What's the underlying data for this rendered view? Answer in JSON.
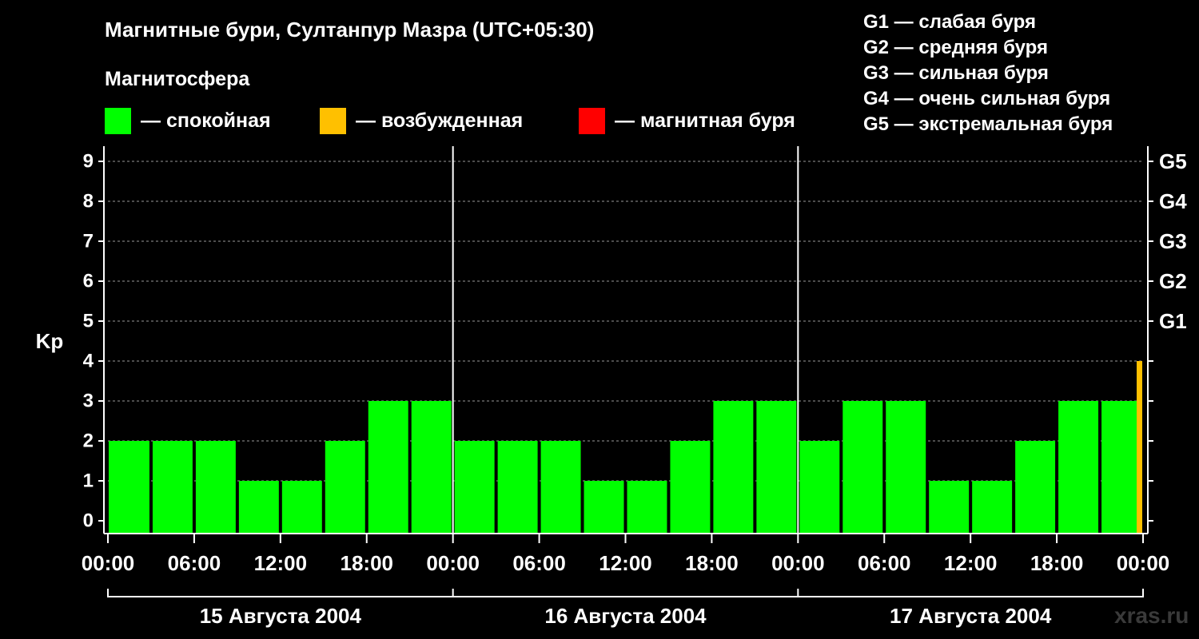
{
  "title": "Магнитные бури, Султанпур Мазра (UTC+05:30)",
  "magnetosphere_label": "Магнитосфера",
  "legend": [
    {
      "color": "#00ff00",
      "label": "— спокойная"
    },
    {
      "color": "#ffc000",
      "label": "— возбужденная"
    },
    {
      "color": "#ff0000",
      "label": "— магнитная буря"
    }
  ],
  "g_scale": [
    "G1 — слабая буря",
    "G2 — средняя буря",
    "G3 — сильная буря",
    "G4 — очень сильная буря",
    "G5 — экстремальная буря"
  ],
  "watermark": "xras.ru",
  "chart_data": {
    "type": "bar",
    "ylabel": "Kp",
    "ylim": [
      0,
      9
    ],
    "y_ticks": [
      "0",
      "1",
      "2",
      "3",
      "4",
      "5",
      "6",
      "7",
      "8",
      "9"
    ],
    "right_axis_ticks": [
      {
        "value": 5,
        "label": "G1"
      },
      {
        "value": 6,
        "label": "G2"
      },
      {
        "value": 7,
        "label": "G3"
      },
      {
        "value": 8,
        "label": "G4"
      },
      {
        "value": 9,
        "label": "G5"
      }
    ],
    "x_tick_labels": [
      "00:00",
      "06:00",
      "12:00",
      "18:00",
      "00:00",
      "06:00",
      "12:00",
      "18:00",
      "00:00",
      "06:00",
      "12:00",
      "18:00",
      "00:00"
    ],
    "days": [
      "15 Августа 2004",
      "16 Августа 2004",
      "17 Августа 2004"
    ],
    "bars": [
      {
        "start_hour": 0,
        "end_hour": 3,
        "value": 2,
        "color": "#00ff00"
      },
      {
        "start_hour": 3,
        "end_hour": 6,
        "value": 2,
        "color": "#00ff00"
      },
      {
        "start_hour": 6,
        "end_hour": 9,
        "value": 2,
        "color": "#00ff00"
      },
      {
        "start_hour": 9,
        "end_hour": 12,
        "value": 1,
        "color": "#00ff00"
      },
      {
        "start_hour": 12,
        "end_hour": 15,
        "value": 1,
        "color": "#00ff00"
      },
      {
        "start_hour": 15,
        "end_hour": 18,
        "value": 2,
        "color": "#00ff00"
      },
      {
        "start_hour": 18,
        "end_hour": 21,
        "value": 3,
        "color": "#00ff00"
      },
      {
        "start_hour": 21,
        "end_hour": 24,
        "value": 3,
        "color": "#00ff00"
      },
      {
        "start_hour": 24,
        "end_hour": 27,
        "value": 2,
        "color": "#00ff00"
      },
      {
        "start_hour": 27,
        "end_hour": 30,
        "value": 2,
        "color": "#00ff00"
      },
      {
        "start_hour": 30,
        "end_hour": 33,
        "value": 2,
        "color": "#00ff00"
      },
      {
        "start_hour": 33,
        "end_hour": 36,
        "value": 1,
        "color": "#00ff00"
      },
      {
        "start_hour": 36,
        "end_hour": 39,
        "value": 1,
        "color": "#00ff00"
      },
      {
        "start_hour": 39,
        "end_hour": 42,
        "value": 2,
        "color": "#00ff00"
      },
      {
        "start_hour": 42,
        "end_hour": 45,
        "value": 3,
        "color": "#00ff00"
      },
      {
        "start_hour": 45,
        "end_hour": 48,
        "value": 3,
        "color": "#00ff00"
      },
      {
        "start_hour": 48,
        "end_hour": 51,
        "value": 2,
        "color": "#00ff00"
      },
      {
        "start_hour": 51,
        "end_hour": 54,
        "value": 3,
        "color": "#00ff00"
      },
      {
        "start_hour": 54,
        "end_hour": 57,
        "value": 3,
        "color": "#00ff00"
      },
      {
        "start_hour": 57,
        "end_hour": 60,
        "value": 1,
        "color": "#00ff00"
      },
      {
        "start_hour": 60,
        "end_hour": 63,
        "value": 1,
        "color": "#00ff00"
      },
      {
        "start_hour": 63,
        "end_hour": 66,
        "value": 2,
        "color": "#00ff00"
      },
      {
        "start_hour": 66,
        "end_hour": 69,
        "value": 3,
        "color": "#00ff00"
      },
      {
        "start_hour": 69,
        "end_hour": 72,
        "value": 3,
        "color": "#00ff00"
      },
      {
        "start_hour": 71.5,
        "end_hour": 72,
        "value": 4,
        "color": "#ffc000"
      }
    ]
  }
}
